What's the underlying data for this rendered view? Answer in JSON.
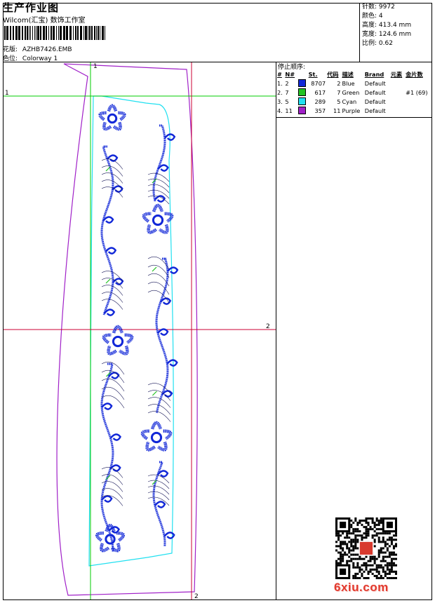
{
  "header": {
    "title": "生产作业图",
    "software": "Wilcom(汇宝) 数饰工作室",
    "design_label": "花版:",
    "design_value": "AZHB7426.EMB",
    "colorway_label": "色位:",
    "colorway_value": "Colorway 1"
  },
  "stats": [
    {
      "label": "针数:",
      "value": "9972"
    },
    {
      "label": "颜色:",
      "value": "4"
    },
    {
      "label": "高度:",
      "value": "413.4 mm"
    },
    {
      "label": "宽度:",
      "value": "124.6 mm"
    },
    {
      "label": "比例:",
      "value": "0.62"
    }
  ],
  "stop_sequence": {
    "title": "停止顺序:",
    "columns": [
      "#",
      "N#",
      "St.",
      "代码",
      "描述",
      "Brand",
      "元素",
      "金片数"
    ],
    "rows": [
      {
        "idx": "1.",
        "n": "2",
        "color": "#1228d8",
        "st": "8707",
        "code": "2",
        "desc": "Blue",
        "brand": "Default",
        "elem": "",
        "seq": ""
      },
      {
        "idx": "2.",
        "n": "7",
        "color": "#22c322",
        "st": "617",
        "code": "7",
        "desc": "Green",
        "brand": "Default",
        "elem": "",
        "seq": "#1 (69)"
      },
      {
        "idx": "3.",
        "n": "5",
        "color": "#20e0f0",
        "st": "289",
        "code": "5",
        "desc": "Cyan",
        "brand": "Default",
        "elem": "",
        "seq": ""
      },
      {
        "idx": "4.",
        "n": "11",
        "color": "#a020c8",
        "st": "357",
        "code": "11",
        "desc": "Purple",
        "brand": "Default",
        "elem": "",
        "seq": ""
      }
    ]
  },
  "guides": {
    "v1_label": "1",
    "h1_label": "1",
    "h2_label": "2",
    "v2_label": "2"
  },
  "colors": {
    "blue": "#1228d8",
    "green": "#22c322",
    "cyan": "#20e0f0",
    "purple": "#a020c8",
    "guide_green": "#00cc00",
    "guide_red": "#cc0033",
    "outline": "#1a1a5a"
  },
  "watermark": "6xiu.com"
}
